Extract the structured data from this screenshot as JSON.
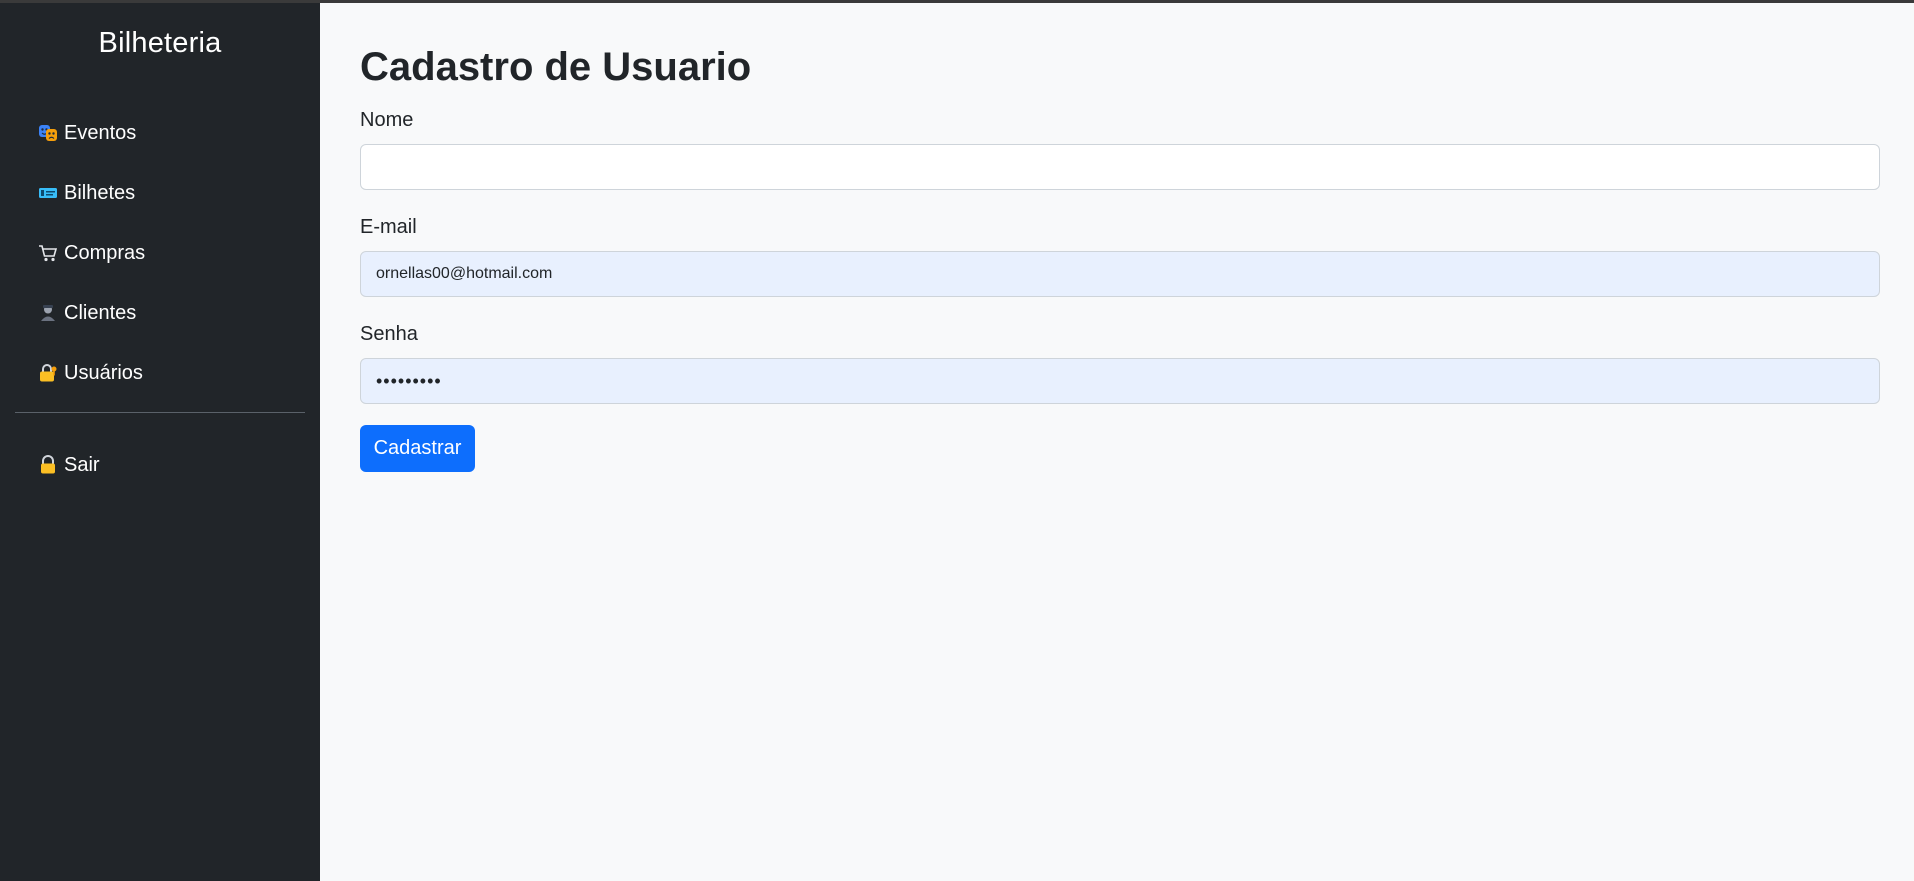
{
  "sidebar": {
    "brand": "Bilheteria",
    "items": [
      {
        "label": "Eventos",
        "icon": "theater-masks-icon"
      },
      {
        "label": "Bilhetes",
        "icon": "ticket-icon"
      },
      {
        "label": "Compras",
        "icon": "shopping-cart-icon"
      },
      {
        "label": "Clientes",
        "icon": "person-icon"
      },
      {
        "label": "Usuários",
        "icon": "lock-key-icon"
      }
    ],
    "logout": {
      "label": "Sair",
      "icon": "padlock-icon"
    }
  },
  "main": {
    "title": "Cadastro de Usuario",
    "form": {
      "name": {
        "label": "Nome",
        "value": ""
      },
      "email": {
        "label": "E-mail",
        "value": "ornellas00@hotmail.com"
      },
      "password": {
        "label": "Senha",
        "value": "•••••••••"
      },
      "submit_label": "Cadastrar"
    }
  },
  "colors": {
    "sidebar_bg": "#212529",
    "page_bg": "#f8f9fa",
    "primary": "#0d6efd",
    "autofill_bg": "#e8f0fe"
  }
}
